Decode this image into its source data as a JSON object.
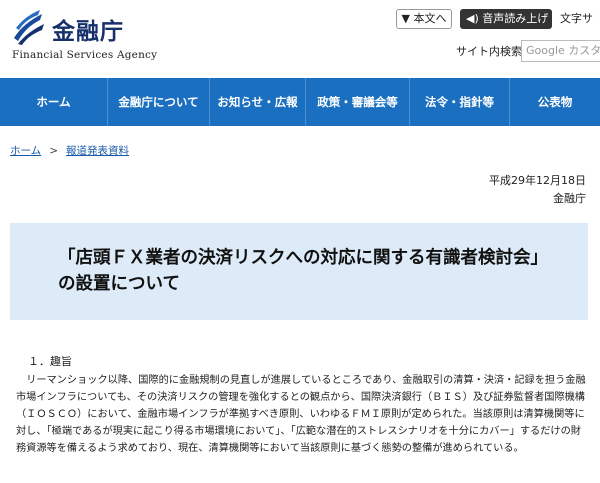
{
  "header": {
    "logo_title": "金融庁",
    "logo_subtitle": "Financial Services Agency",
    "logo_icon": "fsa-logo-icon",
    "honbun_label": "▼ 本文へ",
    "voice_label": "音声読み上げ",
    "voice_icon": "speaker-icon",
    "font_size_label": "文字サ",
    "search_label": "サイト内検索",
    "search_placeholder": "Google カスタ"
  },
  "nav": {
    "items": [
      {
        "label": "ホーム"
      },
      {
        "label": "金融庁について"
      },
      {
        "label": "お知らせ・広報"
      },
      {
        "label": "政策・審議会等"
      },
      {
        "label": "法令・指針等"
      },
      {
        "label": "公表物"
      }
    ],
    "color": "#1a6fc0"
  },
  "breadcrumb": {
    "home": "ホーム",
    "separator": ">",
    "current": "報道発表資料"
  },
  "meta": {
    "date": "平成29年12月18日",
    "agency": "金融庁"
  },
  "title": "「店頭ＦＸ業者の決済リスクへの対応に関する有識者検討会」の設置について",
  "section": {
    "heading": "１．趣旨",
    "body": "リーマンショック以降、国際的に金融規制の見直しが進展しているところであり、金融取引の清算・決済・記録を担う金融市場インフラについても、その決済リスクの管理を強化するとの観点から、国際決済銀行（ＢＩＳ）及び証券監督者国際機構（ＩＯＳＣＯ）において、金融市場インフラが準拠すべき原則、いわゆるＦＭＩ原則が定められた。当該原則は清算機関等に対し、「極端であるが現実に起こり得る市場環境において」、「広範な潜在的ストレスシナリオを十分にカバー」するだけの財務資源等を備えるよう求めており、現在、清算機関等において当該原則に基づく態勢の整備が進められている。"
  }
}
